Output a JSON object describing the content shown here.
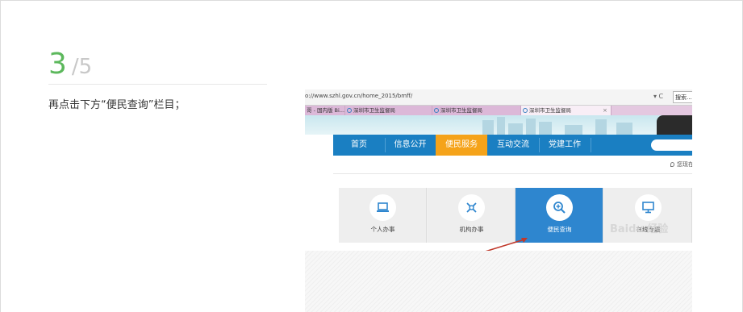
{
  "step": {
    "current": "3",
    "total": "/5"
  },
  "instruction": "再点击下方“便民查询”栏目；",
  "screenshot": {
    "url": "o://www.szhl.gov.cn/home_2015/bmff/",
    "address_controls": "▾ C",
    "search_label": "搜索...",
    "tabs": [
      {
        "label": "哥 - 国内版 Bi..."
      },
      {
        "label": "深圳市卫生监督局"
      },
      {
        "label": "深圳市卫生监督局"
      },
      {
        "label": "深圳市卫生监督局"
      }
    ],
    "tab_close": "×",
    "nav": [
      {
        "label": "首页"
      },
      {
        "label": "信息公开"
      },
      {
        "label": "便民服务"
      },
      {
        "label": "互动交流"
      },
      {
        "label": "党建工作"
      }
    ],
    "location_text": "您现在",
    "cards": [
      {
        "label": "个人办事",
        "icon": "laptop-icon"
      },
      {
        "label": "机构办事",
        "icon": "tools-icon"
      },
      {
        "label": "便民查询",
        "icon": "magnifier-plus-icon"
      },
      {
        "label": "在线专题",
        "icon": "monitor-icon"
      }
    ],
    "watermark": "Baidu 经验"
  },
  "colors": {
    "step_green": "#5cb85c",
    "nav_blue": "#1a7fc2",
    "nav_active_orange": "#f5a31a",
    "card_active_blue": "#2e86cf",
    "arrow_red": "#c0392b"
  }
}
